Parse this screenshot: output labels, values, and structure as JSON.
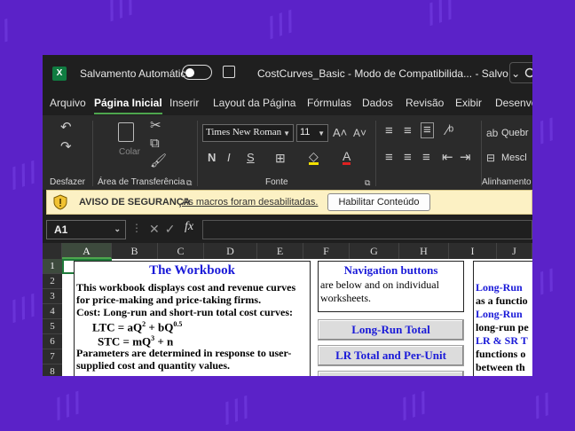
{
  "titlebar": {
    "app_logo": "X",
    "autosave_label": "Salvamento Automático",
    "document_title": "CostCurves_Basic  -  Modo de Compatibilida...  -  Salvo  ⌄"
  },
  "tabs": [
    "Arquivo",
    "Página Inicial",
    "Inserir",
    "Layout da Página",
    "Fórmulas",
    "Dados",
    "Revisão",
    "Exibir",
    "Desenvo"
  ],
  "ribbon": {
    "undo_label": "Desfazer",
    "clipboard_label": "Área de Transferência",
    "paste_label": "Colar",
    "font_group_label": "Fonte",
    "font_name": "Times New Roman",
    "font_size": "11",
    "alignment_group_label": "Alinhamento",
    "wrap_label": "Quebr",
    "merge_label": "Mescl"
  },
  "security_bar": {
    "title": "AVISO DE SEGURANÇA",
    "message": "As macros foram desabilitadas.",
    "button": "Habilitar Conteúdo"
  },
  "formula_bar": {
    "name_box": "A1",
    "fx": "fx"
  },
  "columns": [
    "A",
    "B",
    "C",
    "D",
    "E",
    "F",
    "G",
    "H",
    "I",
    "J"
  ],
  "rows": [
    "1",
    "2",
    "3",
    "4",
    "5",
    "6",
    "7",
    "8"
  ],
  "workbook_box": {
    "title": "The Workbook",
    "lines": [
      "This workbook displays cost and revenue curves",
      "for price-making and price-taking firms.",
      "Cost: Long-run and short-run total cost curves:",
      "LTC = aQ",
      "2",
      " + bQ",
      "0.5",
      "STC = mQ",
      "3",
      " + n",
      "Parameters are determined in response to user-",
      "supplied cost and quantity values."
    ]
  },
  "nav_box": {
    "title": "Navigation buttons",
    "lines": [
      "are below and on individual",
      "worksheets."
    ]
  },
  "nav_buttons": [
    "Long-Run Total",
    "LR Total and Per-Unit"
  ],
  "right_box": {
    "lines": [
      "Long-Run ",
      "as a functio",
      "Long-Run ",
      "long-run pe",
      "LR & SR T",
      "functions o",
      "between th"
    ]
  },
  "colors": {
    "background": "#5b22c8",
    "accent_green": "#4ea64e",
    "title_blue": "#1a1ad8",
    "security_yellow": "#fcf1c4"
  }
}
